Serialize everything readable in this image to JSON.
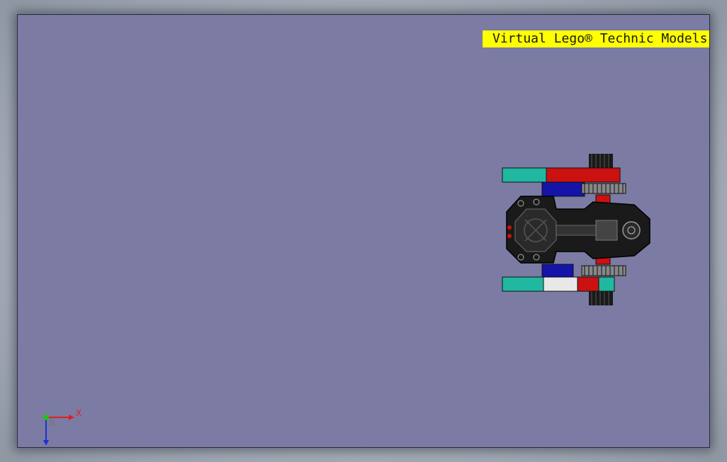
{
  "banner": {
    "text": "Virtual Lego® Technic Models"
  },
  "triad": {
    "x_label": "X",
    "x_color": "#e02020",
    "y_color": "#2030d0",
    "origin_color": "#20c020"
  },
  "colors": {
    "viewport_background": "#7b7ba4",
    "banner_background": "#ffff00",
    "beam_teal": "#20b8a0",
    "beam_red": "#cc1111",
    "beam_blue": "#1414a8",
    "beam_yellow": "#c8c000",
    "part_black": "#1a1a1a"
  }
}
